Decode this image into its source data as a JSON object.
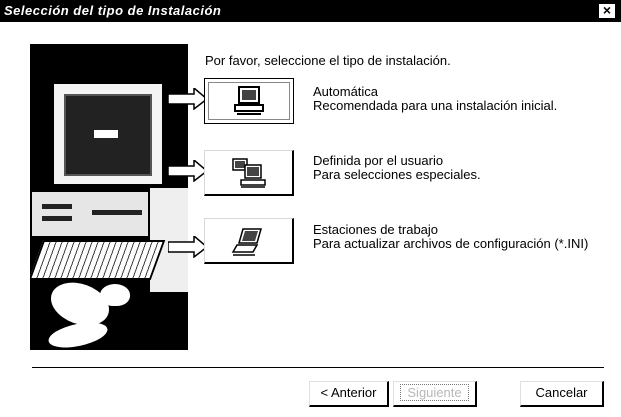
{
  "window": {
    "title": "Selección del tipo de Instalación",
    "close_glyph": "×"
  },
  "prompt": "Por favor, seleccione el tipo de instalación.",
  "options": [
    {
      "title": "Automática",
      "desc": "Recomendada para una instalación inicial.",
      "icon": "single-computer-icon"
    },
    {
      "title": "Definida por el usuario",
      "desc": "Para selecciones especiales.",
      "icon": "multiple-computers-icon"
    },
    {
      "title": "Estaciones de trabajo",
      "desc": "Para actualizar archivos de configuración (*.INI)",
      "icon": "laptop-icon"
    }
  ],
  "buttons": {
    "back": "< Anterior",
    "next": "Siguiente",
    "cancel": "Cancelar"
  },
  "colors": {
    "title_bar": "#000000",
    "background": "#ffffff",
    "disabled_text": "#b8b8b8"
  }
}
